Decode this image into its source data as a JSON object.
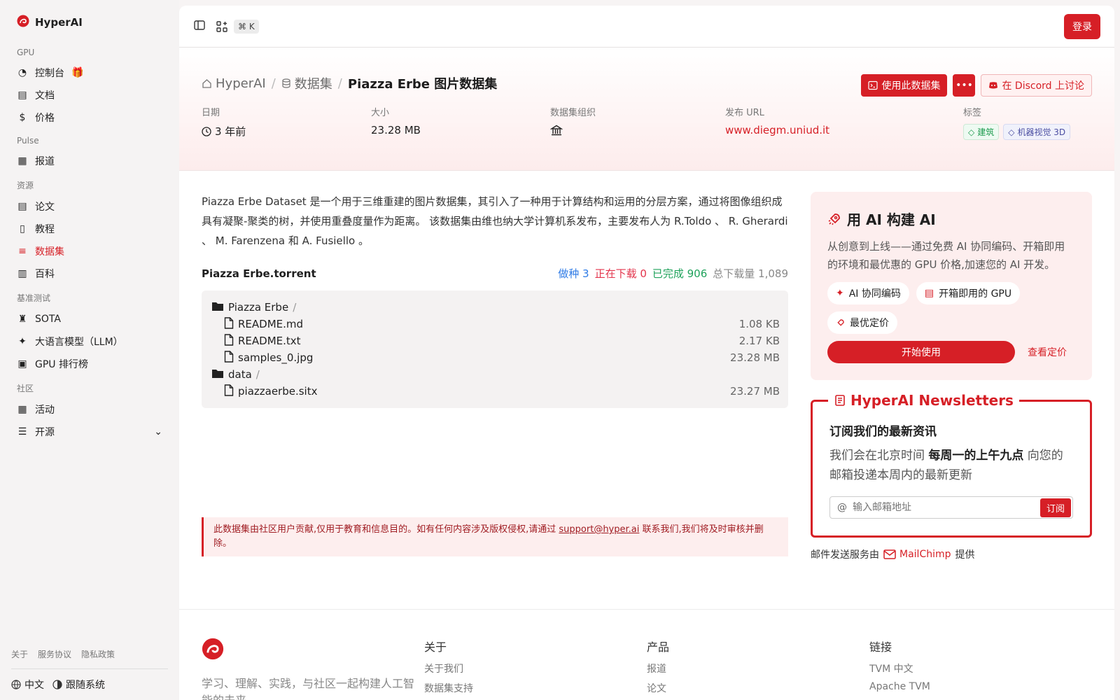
{
  "brand": {
    "name": "HyperAI",
    "accent": "#d61f26"
  },
  "sidebar": {
    "groups": [
      {
        "title": "GPU",
        "items": [
          {
            "label": "控制台",
            "icon": "gauge-icon"
          },
          {
            "label": "文档",
            "icon": "doc-icon"
          },
          {
            "label": "价格",
            "icon": "dollar-icon"
          }
        ]
      },
      {
        "title": "Pulse",
        "items": [
          {
            "label": "报道",
            "icon": "news-icon"
          }
        ]
      },
      {
        "title": "资源",
        "items": [
          {
            "label": "论文",
            "icon": "paper-icon"
          },
          {
            "label": "教程",
            "icon": "book-icon"
          },
          {
            "label": "数据集",
            "icon": "database-icon",
            "active": true
          },
          {
            "label": "百科",
            "icon": "wiki-icon"
          }
        ]
      },
      {
        "title": "基准测试",
        "items": [
          {
            "label": "SOTA",
            "icon": "trophy-icon"
          },
          {
            "label": "大语言模型（LLM）",
            "icon": "sparkle-icon"
          },
          {
            "label": "GPU 排行榜",
            "icon": "chip-icon"
          }
        ]
      },
      {
        "title": "社区",
        "items": [
          {
            "label": "活动",
            "icon": "calendar-icon"
          },
          {
            "label": "开源",
            "icon": "list-icon"
          }
        ]
      }
    ],
    "footer_links": [
      "关于",
      "服务协议",
      "隐私政策"
    ],
    "language": "中文",
    "theme": "跟随系统"
  },
  "topbar": {
    "shortcut": "⌘ K",
    "login": "登录"
  },
  "header": {
    "breadcrumb": {
      "home": "HyperAI",
      "section": "数据集",
      "current": "Piazza Erbe 图片数据集"
    },
    "use_button": "使用此数据集",
    "discord_button": "在 Discord 上讨论",
    "meta": {
      "date_label": "日期",
      "date_value": "3 年前",
      "size_label": "大小",
      "size_value": "23.28 MB",
      "org_label": "数据集组织",
      "url_label": "发布 URL",
      "url_value": "www.diegm.uniud.it",
      "tags_label": "标签",
      "tags": [
        "建筑",
        "机器视觉 3D"
      ]
    }
  },
  "description": "Piazza Erbe Dataset 是一个用于三维重建的图片数据集，其引入了一种用于计算结构和运用的分层方案，通过将图像组织成具有凝聚-聚类的树，并使用重叠度量作为距离。 该数据集由维也纳大学计算机系发布，主要发布人为 R.Toldo 、 R. Gherardi 、 M. Farenzena 和 A. Fusiello 。",
  "torrent": {
    "title": "Piazza Erbe.torrent",
    "seeding": "做种 3",
    "downloading": "正在下载 0",
    "completed": "已完成 906",
    "total": "总下载量 1,089",
    "files": [
      {
        "name": "Piazza Erbe",
        "folder": true,
        "size": ""
      },
      {
        "name": "README.md",
        "folder": false,
        "size": "1.08 KB"
      },
      {
        "name": "README.txt",
        "folder": false,
        "size": "2.17 KB"
      },
      {
        "name": "samples_0.jpg",
        "folder": false,
        "size": "23.28 MB"
      },
      {
        "name": "data",
        "folder": true,
        "size": ""
      },
      {
        "name": "piazzaerbe.sitx",
        "folder": false,
        "size": "23.27 MB"
      }
    ]
  },
  "disclaimer": {
    "before": "此数据集由社区用户贡献,仅用于教育和信息目的。如有任何内容涉及版权侵权,请通过 ",
    "email": "support@hyper.ai",
    "after": " 联系我们,我们将及时审核并删除。"
  },
  "promo": {
    "title": "用 AI 构建 AI",
    "text": "从创意到上线——通过免费 AI 协同编码、开箱即用的环境和最优惠的 GPU 价格,加速您的 AI 开发。",
    "features": [
      "AI 协同编码",
      "开箱即用的 GPU",
      "最优定价"
    ],
    "start": "开始使用",
    "pricing": "查看定价"
  },
  "newsletter": {
    "legend": "HyperAI Newsletters",
    "title": "订阅我们的最新资讯",
    "text_before": "我们会在北京时间 ",
    "text_bold": "每周一的上午九点",
    "text_after": " 向您的邮箱投递本周内的最新更新",
    "placeholder": "输入邮箱地址",
    "button": "订阅",
    "provider_before": "邮件发送服务由",
    "provider": "MailChimp",
    "provider_after": "提供"
  },
  "footer": {
    "tagline": "学习、理解、实践，与社区一起构建人工智能的未来",
    "cols": [
      {
        "title": "关于",
        "links": [
          "关于我们",
          "数据集支持"
        ]
      },
      {
        "title": "产品",
        "links": [
          "报道",
          "论文"
        ]
      },
      {
        "title": "链接",
        "links": [
          "TVM 中文",
          "Apache TVM"
        ]
      }
    ]
  }
}
